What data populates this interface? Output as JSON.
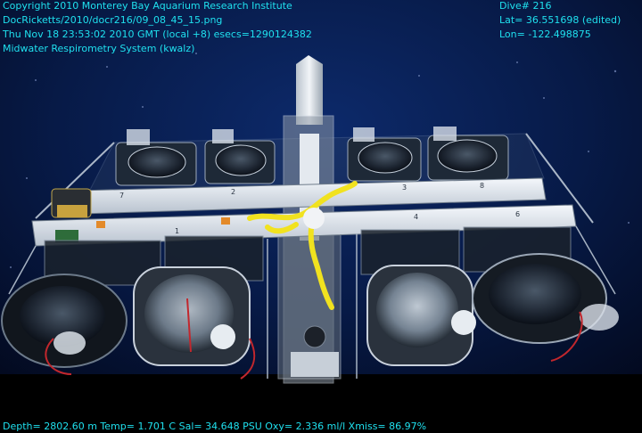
{
  "overlay": {
    "top_left": [
      "Copyright 2010 Monterey Bay Aquarium Research Institute",
      "DocRicketts/2010/docr216/09_08_45_15.png",
      "Thu Nov 18 23:53:02 2010 GMT (local +8)  esecs=1290124382",
      "Midwater Respirometry System (kwalz)"
    ],
    "top_right": [
      "Dive# 216",
      "Lat= 36.551698 (edited)",
      "Lon= -122.498875"
    ],
    "bottom": "Depth= 2802.60 m  Temp= 1.701 C  Sal= 34.648 PSU  Oxy= 2.336 ml/l  Xmiss= 86.97%"
  },
  "scene": {
    "labels": [
      "7",
      "2",
      "3",
      "8",
      "1",
      "4",
      "6"
    ]
  },
  "colors": {
    "overlay_text": "#1fe0ee",
    "water": "#071a47",
    "rail": "#dfe6ee",
    "rope": "#f1e21f"
  }
}
